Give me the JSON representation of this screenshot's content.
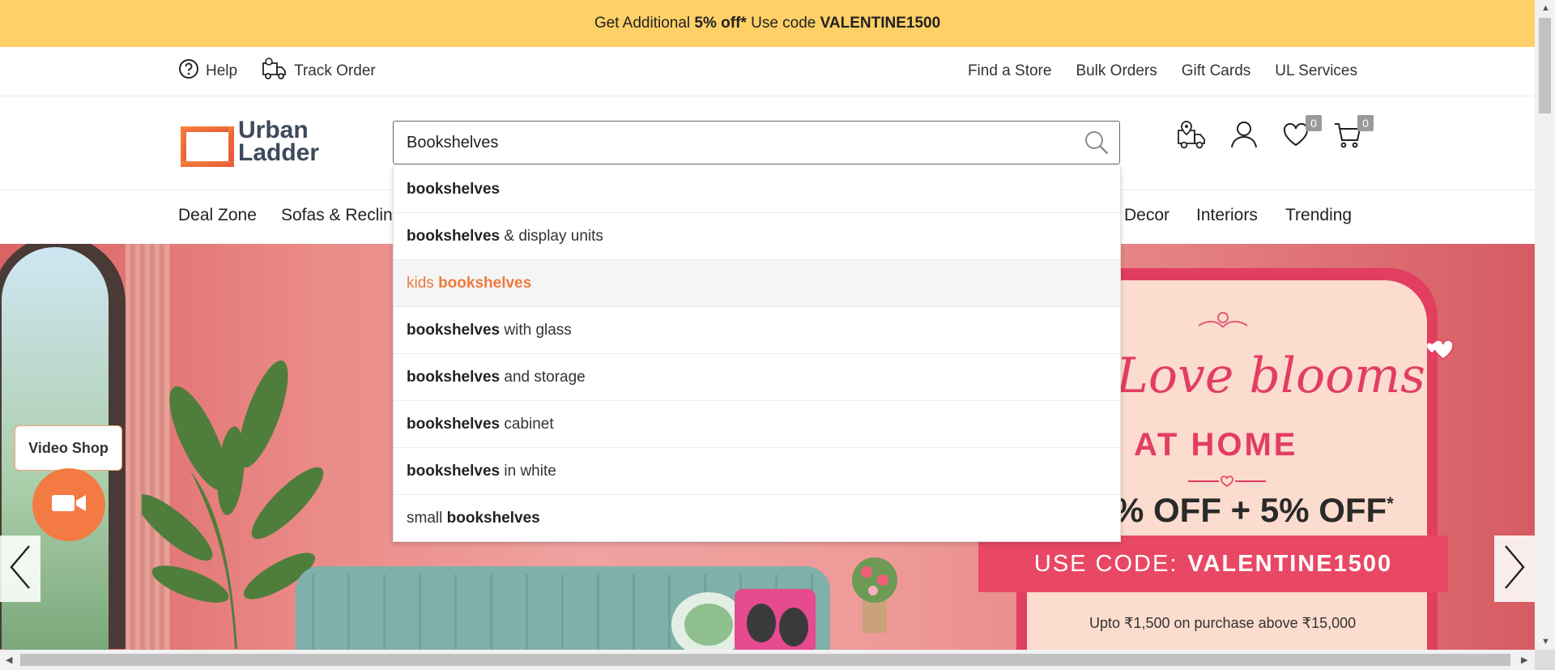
{
  "promo": {
    "prefix": "Get Additional ",
    "highlight": "5% off*",
    "middle": " Use code ",
    "code": "VALENTINE1500"
  },
  "utility": {
    "help": "Help",
    "track": "Track Order",
    "links": [
      "Find a Store",
      "Bulk Orders",
      "Gift Cards",
      "UL Services"
    ]
  },
  "logo": {
    "line1": "Urban",
    "line2": "Ladder",
    "accent": "#f37a43"
  },
  "search": {
    "value": "Bookshelves",
    "placeholder": "Search"
  },
  "header_icons": {
    "wishlist_count": "0",
    "cart_count": "0"
  },
  "nav": [
    "Deal Zone",
    "Sofas & Reclin",
    "Decor",
    "Interiors",
    "Trending"
  ],
  "suggestions": [
    {
      "pre": "",
      "bold": "bookshelves",
      "post": ""
    },
    {
      "pre": "",
      "bold": "bookshelves",
      "post": " & display units"
    },
    {
      "pre": "kids ",
      "bold": "bookshelves",
      "post": ""
    },
    {
      "pre": "",
      "bold": "bookshelves",
      "post": " with glass"
    },
    {
      "pre": "",
      "bold": "bookshelves",
      "post": " and storage"
    },
    {
      "pre": "",
      "bold": "bookshelves",
      "post": " cabinet"
    },
    {
      "pre": "",
      "bold": "bookshelves",
      "post": " in white"
    },
    {
      "pre": "small ",
      "bold": "bookshelves",
      "post": ""
    }
  ],
  "active_suggestion_index": 2,
  "hero": {
    "headline": "Love blooms",
    "sub": "AT HOME",
    "offer": "% OFF + 5% OFF",
    "offer_sup": "*",
    "ribbon_label": "USE CODE:",
    "ribbon_code": "VALENTINE1500",
    "fine_print": "Upto ₹1,500 on purchase above  ₹15,000"
  },
  "video_shop": {
    "label": "Video Shop"
  },
  "colors": {
    "promo_bg": "#ffd067",
    "accent": "#f37a43",
    "brand_red": "#e23e5f"
  }
}
